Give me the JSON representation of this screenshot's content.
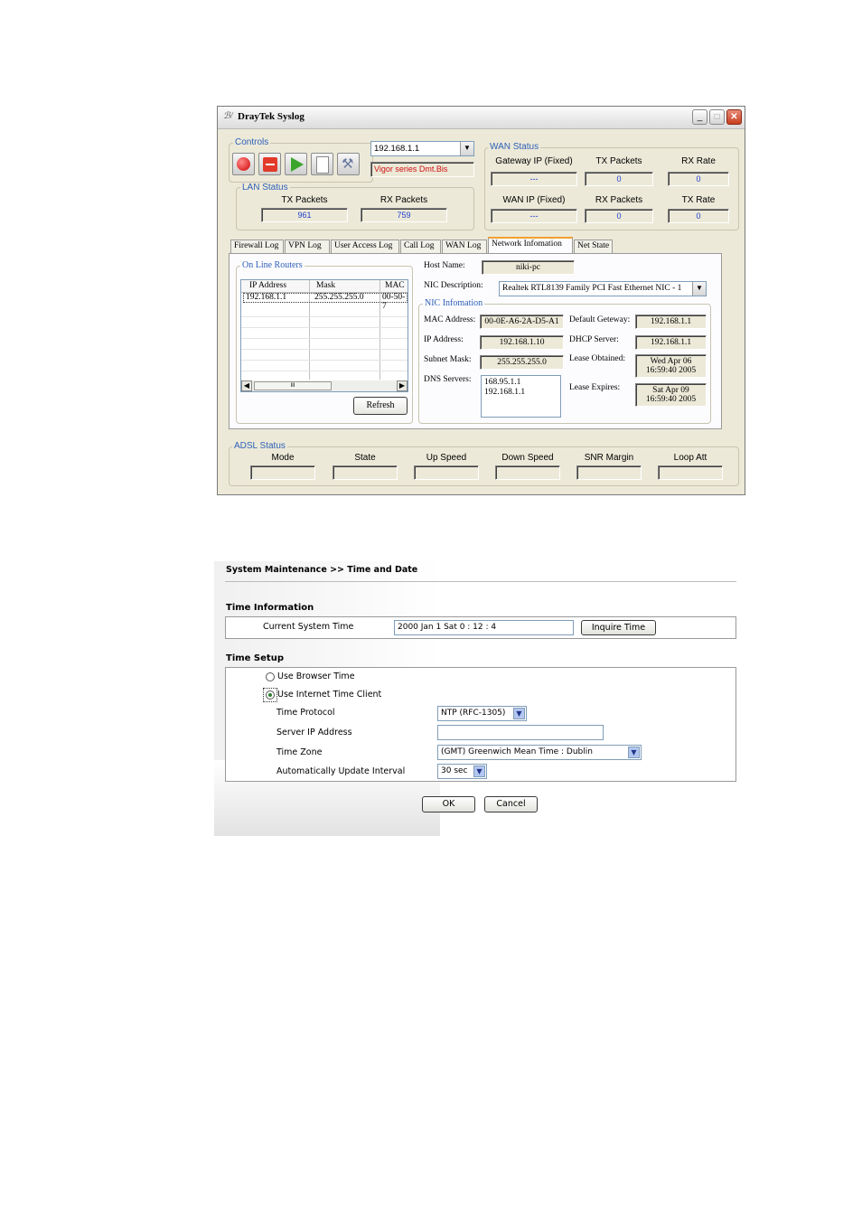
{
  "syslog": {
    "title": "DrayTek Syslog",
    "controls": {
      "label": "Controls",
      "ip_value": "192.168.1.1",
      "model_text": "Vigor series Dmt.Bis",
      "buttons": [
        "record-icon",
        "stop-icon",
        "play-icon",
        "document-icon",
        "tools-icon"
      ]
    },
    "wan_status": {
      "label": "WAN Status",
      "headers_row1": [
        "Gateway IP (Fixed)",
        "TX Packets",
        "RX Rate"
      ],
      "values_row1": [
        "---",
        "0",
        "0"
      ],
      "headers_row2": [
        "WAN IP (Fixed)",
        "RX Packets",
        "TX Rate"
      ],
      "values_row2": [
        "---",
        "0",
        "0"
      ]
    },
    "lan_status": {
      "label": "LAN Status",
      "headers": [
        "TX Packets",
        "RX Packets"
      ],
      "values": [
        "961",
        "759"
      ]
    },
    "tabs": [
      "Firewall Log",
      "VPN Log",
      "User Access Log",
      "Call Log",
      "WAN Log",
      "Network Infomation",
      "Net State"
    ],
    "online_routers": {
      "label": "On Line Routers",
      "columns": [
        "IP Address",
        "Mask",
        "MAC"
      ],
      "row": [
        "192.168.1.1",
        "255.255.255.0",
        "00-50-7"
      ],
      "scroll_mid": "III",
      "refresh_label": "Refresh"
    },
    "host_name_label": "Host Name:",
    "host_name_value": "niki-pc",
    "nic_desc_label": "NIC Description:",
    "nic_desc_value": "Realtek RTL8139 Family PCI Fast Ethernet NIC - 1",
    "nic_info": {
      "label": "NIC Infomation",
      "mac_label": "MAC Address:",
      "mac_value": "00-0E-A6-2A-D5-A1",
      "ip_label": "IP Address:",
      "ip_value": "192.168.1.10",
      "subnet_label": "Subnet Mask:",
      "subnet_value": "255.255.255.0",
      "dns_label": "DNS Servers:",
      "dns_value1": "168.95.1.1",
      "dns_value2": "192.168.1.1",
      "gw_label": "Default Geteway:",
      "gw_value": "192.168.1.1",
      "dhcp_label": "DHCP Server:",
      "dhcp_value": "192.168.1.1",
      "lease_obt_label": "Lease Obtained:",
      "lease_obt_value1": "Wed Apr 06",
      "lease_obt_value2": "16:59:40 2005",
      "lease_exp_label": "Lease Expires:",
      "lease_exp_value1": "Sat Apr 09",
      "lease_exp_value2": "16:59:40 2005"
    },
    "adsl_status": {
      "label": "ADSL Status",
      "headers": [
        "Mode",
        "State",
        "Up Speed",
        "Down Speed",
        "SNR Margin",
        "Loop Att"
      ]
    }
  },
  "web": {
    "breadcrumb": "System Maintenance >> Time and Date",
    "time_info_title": "Time Information",
    "current_time_label": "Current System Time",
    "current_time_value": "2000 Jan 1 Sat 0 : 12 : 4",
    "inquire_label": "Inquire Time",
    "time_setup_title": "Time Setup",
    "use_browser_label": "Use Browser Time",
    "use_internet_label": "Use Internet Time Client",
    "protocol_label": "Time Protocol",
    "protocol_value": "NTP (RFC-1305)",
    "server_ip_label": "Server IP Address",
    "server_ip_value": "",
    "time_zone_label": "Time Zone",
    "time_zone_value": "(GMT) Greenwich Mean Time : Dublin",
    "interval_label": "Automatically Update Interval",
    "interval_value": "30 sec",
    "ok_label": "OK",
    "cancel_label": "Cancel"
  }
}
